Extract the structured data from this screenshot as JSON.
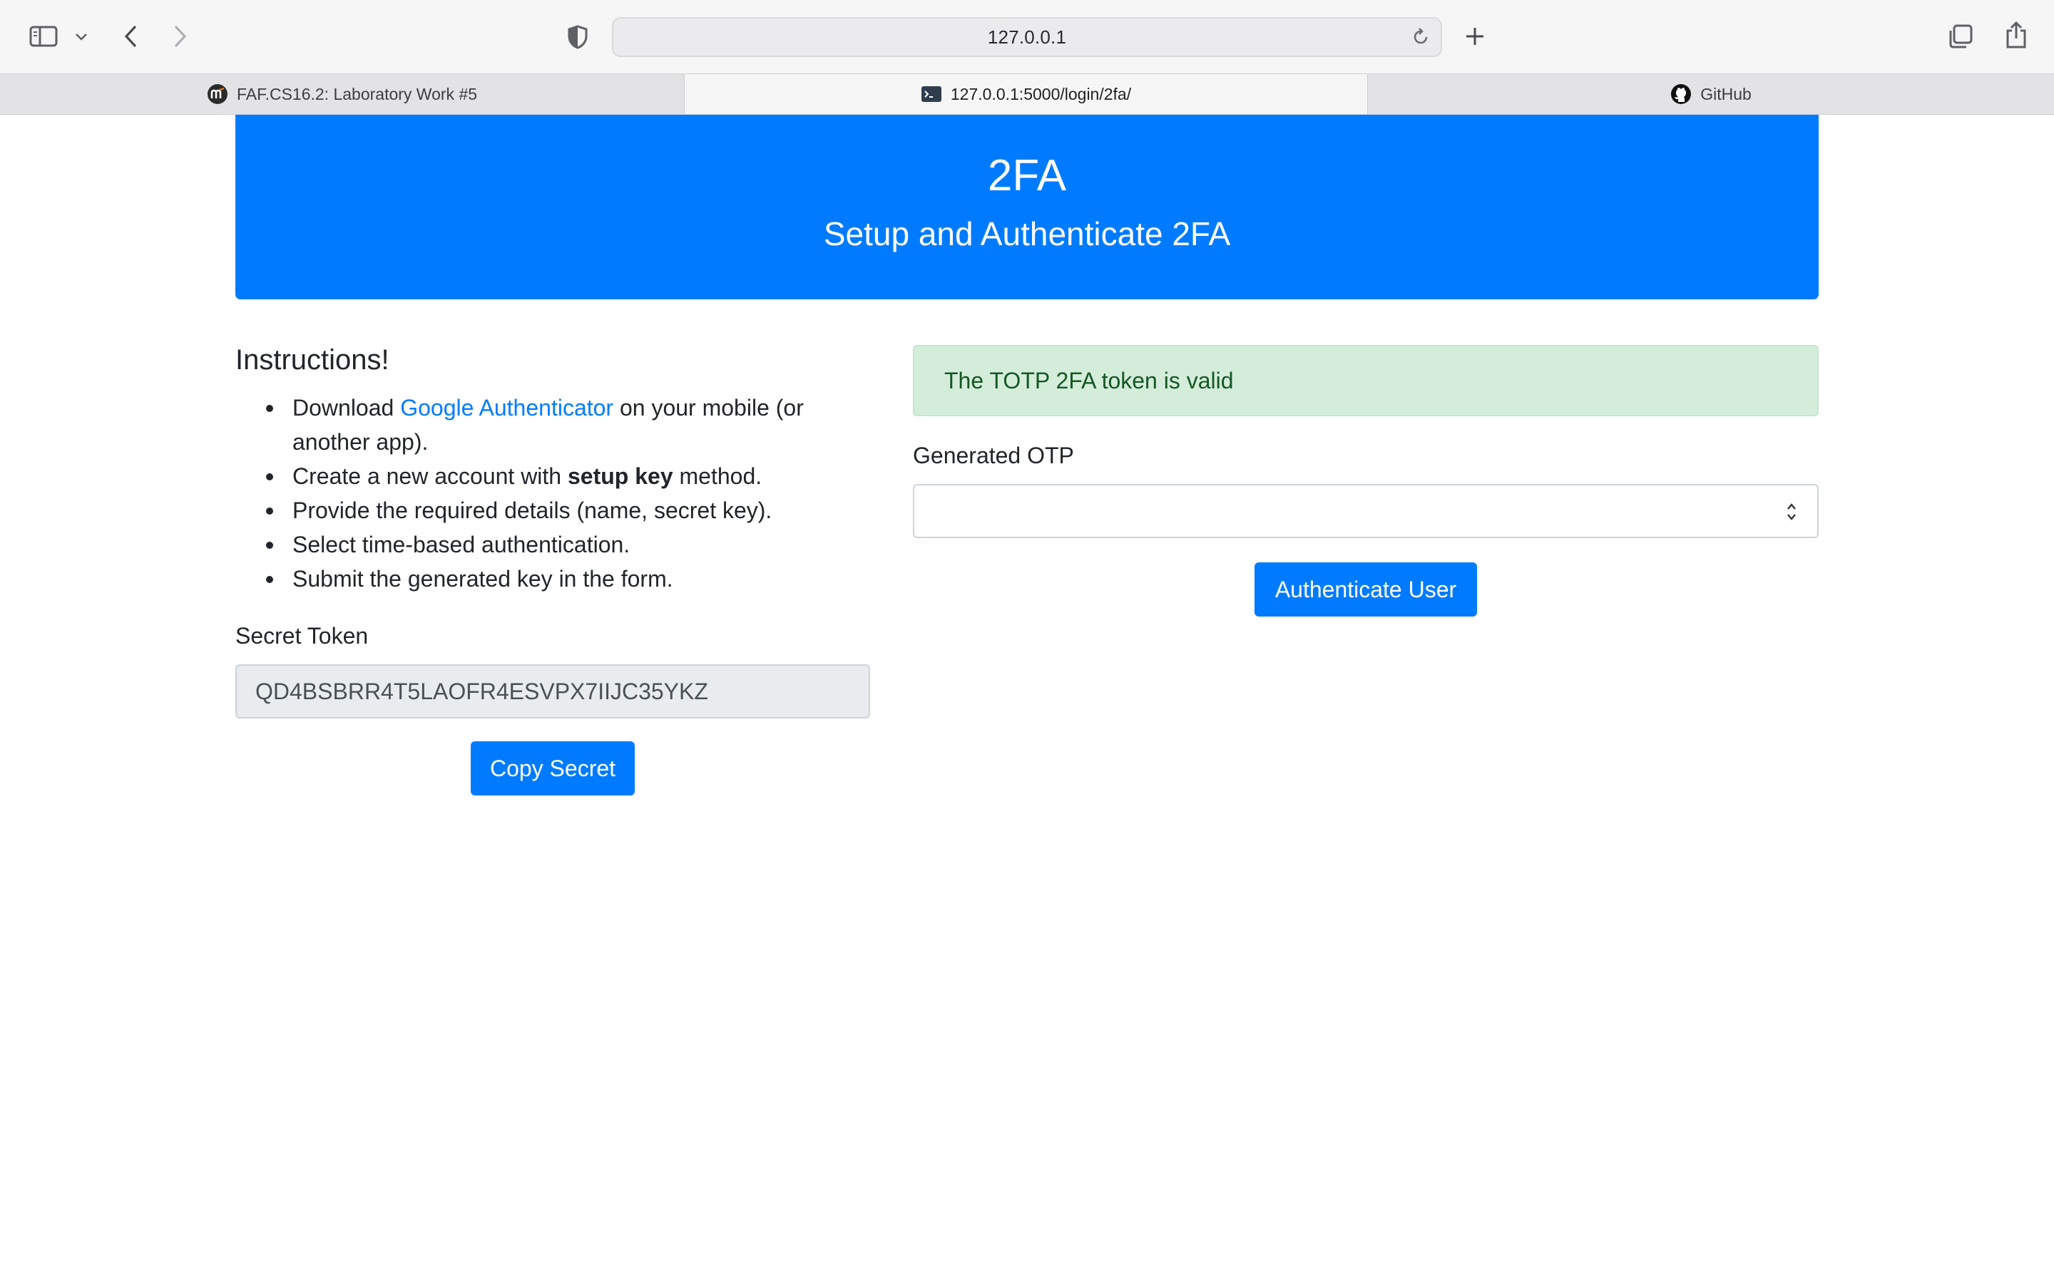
{
  "browser": {
    "url": "127.0.0.1",
    "tabs": [
      {
        "title": "FAF.CS16.2: Laboratory Work #5",
        "icon": "moodle-icon",
        "active": false
      },
      {
        "title": "127.0.0.1:5000/login/2fa/",
        "icon": "terminal-icon",
        "active": true
      },
      {
        "title": "GitHub",
        "icon": "github-icon",
        "active": false
      }
    ]
  },
  "header": {
    "title": "2FA",
    "subtitle": "Setup and Authenticate 2FA"
  },
  "instructions": {
    "title": "Instructions!",
    "items": [
      {
        "pre": "Download ",
        "link": "Google Authenticator",
        "post": " on your mobile (or another app)."
      },
      {
        "pre": "Create a new account with ",
        "bold": "setup key",
        "post": " method."
      },
      {
        "text": "Provide the required details (name, secret key)."
      },
      {
        "text": "Select time-based authentication."
      },
      {
        "text": "Submit the generated key in the form."
      }
    ]
  },
  "secret": {
    "label": "Secret Token",
    "value": "QD4BSBRR4T5LAOFR4ESVPX7IIJC35YKZ",
    "button": "Copy Secret"
  },
  "auth": {
    "alert": "The TOTP 2FA token is valid",
    "otp_label": "Generated OTP",
    "otp_value": "",
    "button": "Authenticate User"
  },
  "colors": {
    "primary": "#007bff",
    "success_bg": "#d4edda",
    "success_text": "#155724"
  }
}
